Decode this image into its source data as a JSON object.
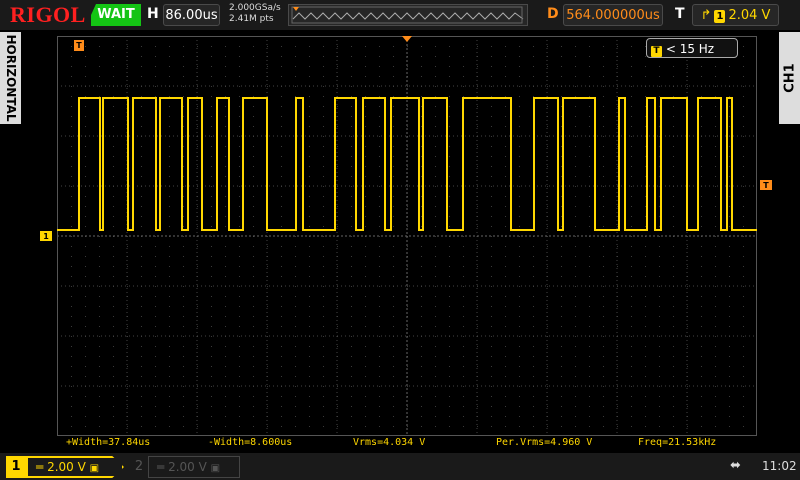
{
  "brand": "RIGOL",
  "status": "WAIT",
  "horizontal": {
    "label": "H",
    "timebase": "86.00us",
    "sample_rate": "2.000GSa/s",
    "memory_depth": "2.41M pts",
    "tab": "HORIZONTAL"
  },
  "delay": {
    "label": "D",
    "value": "564.000000us"
  },
  "trigger": {
    "label": "T",
    "source": "1",
    "level": "2.04 V",
    "marker": "T"
  },
  "right_tab": "CH1",
  "freq_counter": {
    "icon": "T",
    "text": "< 15 Hz"
  },
  "channel_marker": "1",
  "measurements": [
    {
      "text": "+Width=37.84us"
    },
    {
      "text": "-Width=8.600us"
    },
    {
      "text": "Vrms=4.034 V"
    },
    {
      "text": "Per.Vrms=4.960 V"
    },
    {
      "text": "Freq=21.53kHz"
    }
  ],
  "channels": [
    {
      "number": "1",
      "scale": "2.00 V"
    },
    {
      "number": "2",
      "scale": "2.00 V"
    }
  ],
  "clock": "11:02",
  "colors": {
    "ch1": "#ffd700",
    "trigger": "#ff8c1a",
    "brand": "#ff2020",
    "wait": "#14c414"
  }
}
